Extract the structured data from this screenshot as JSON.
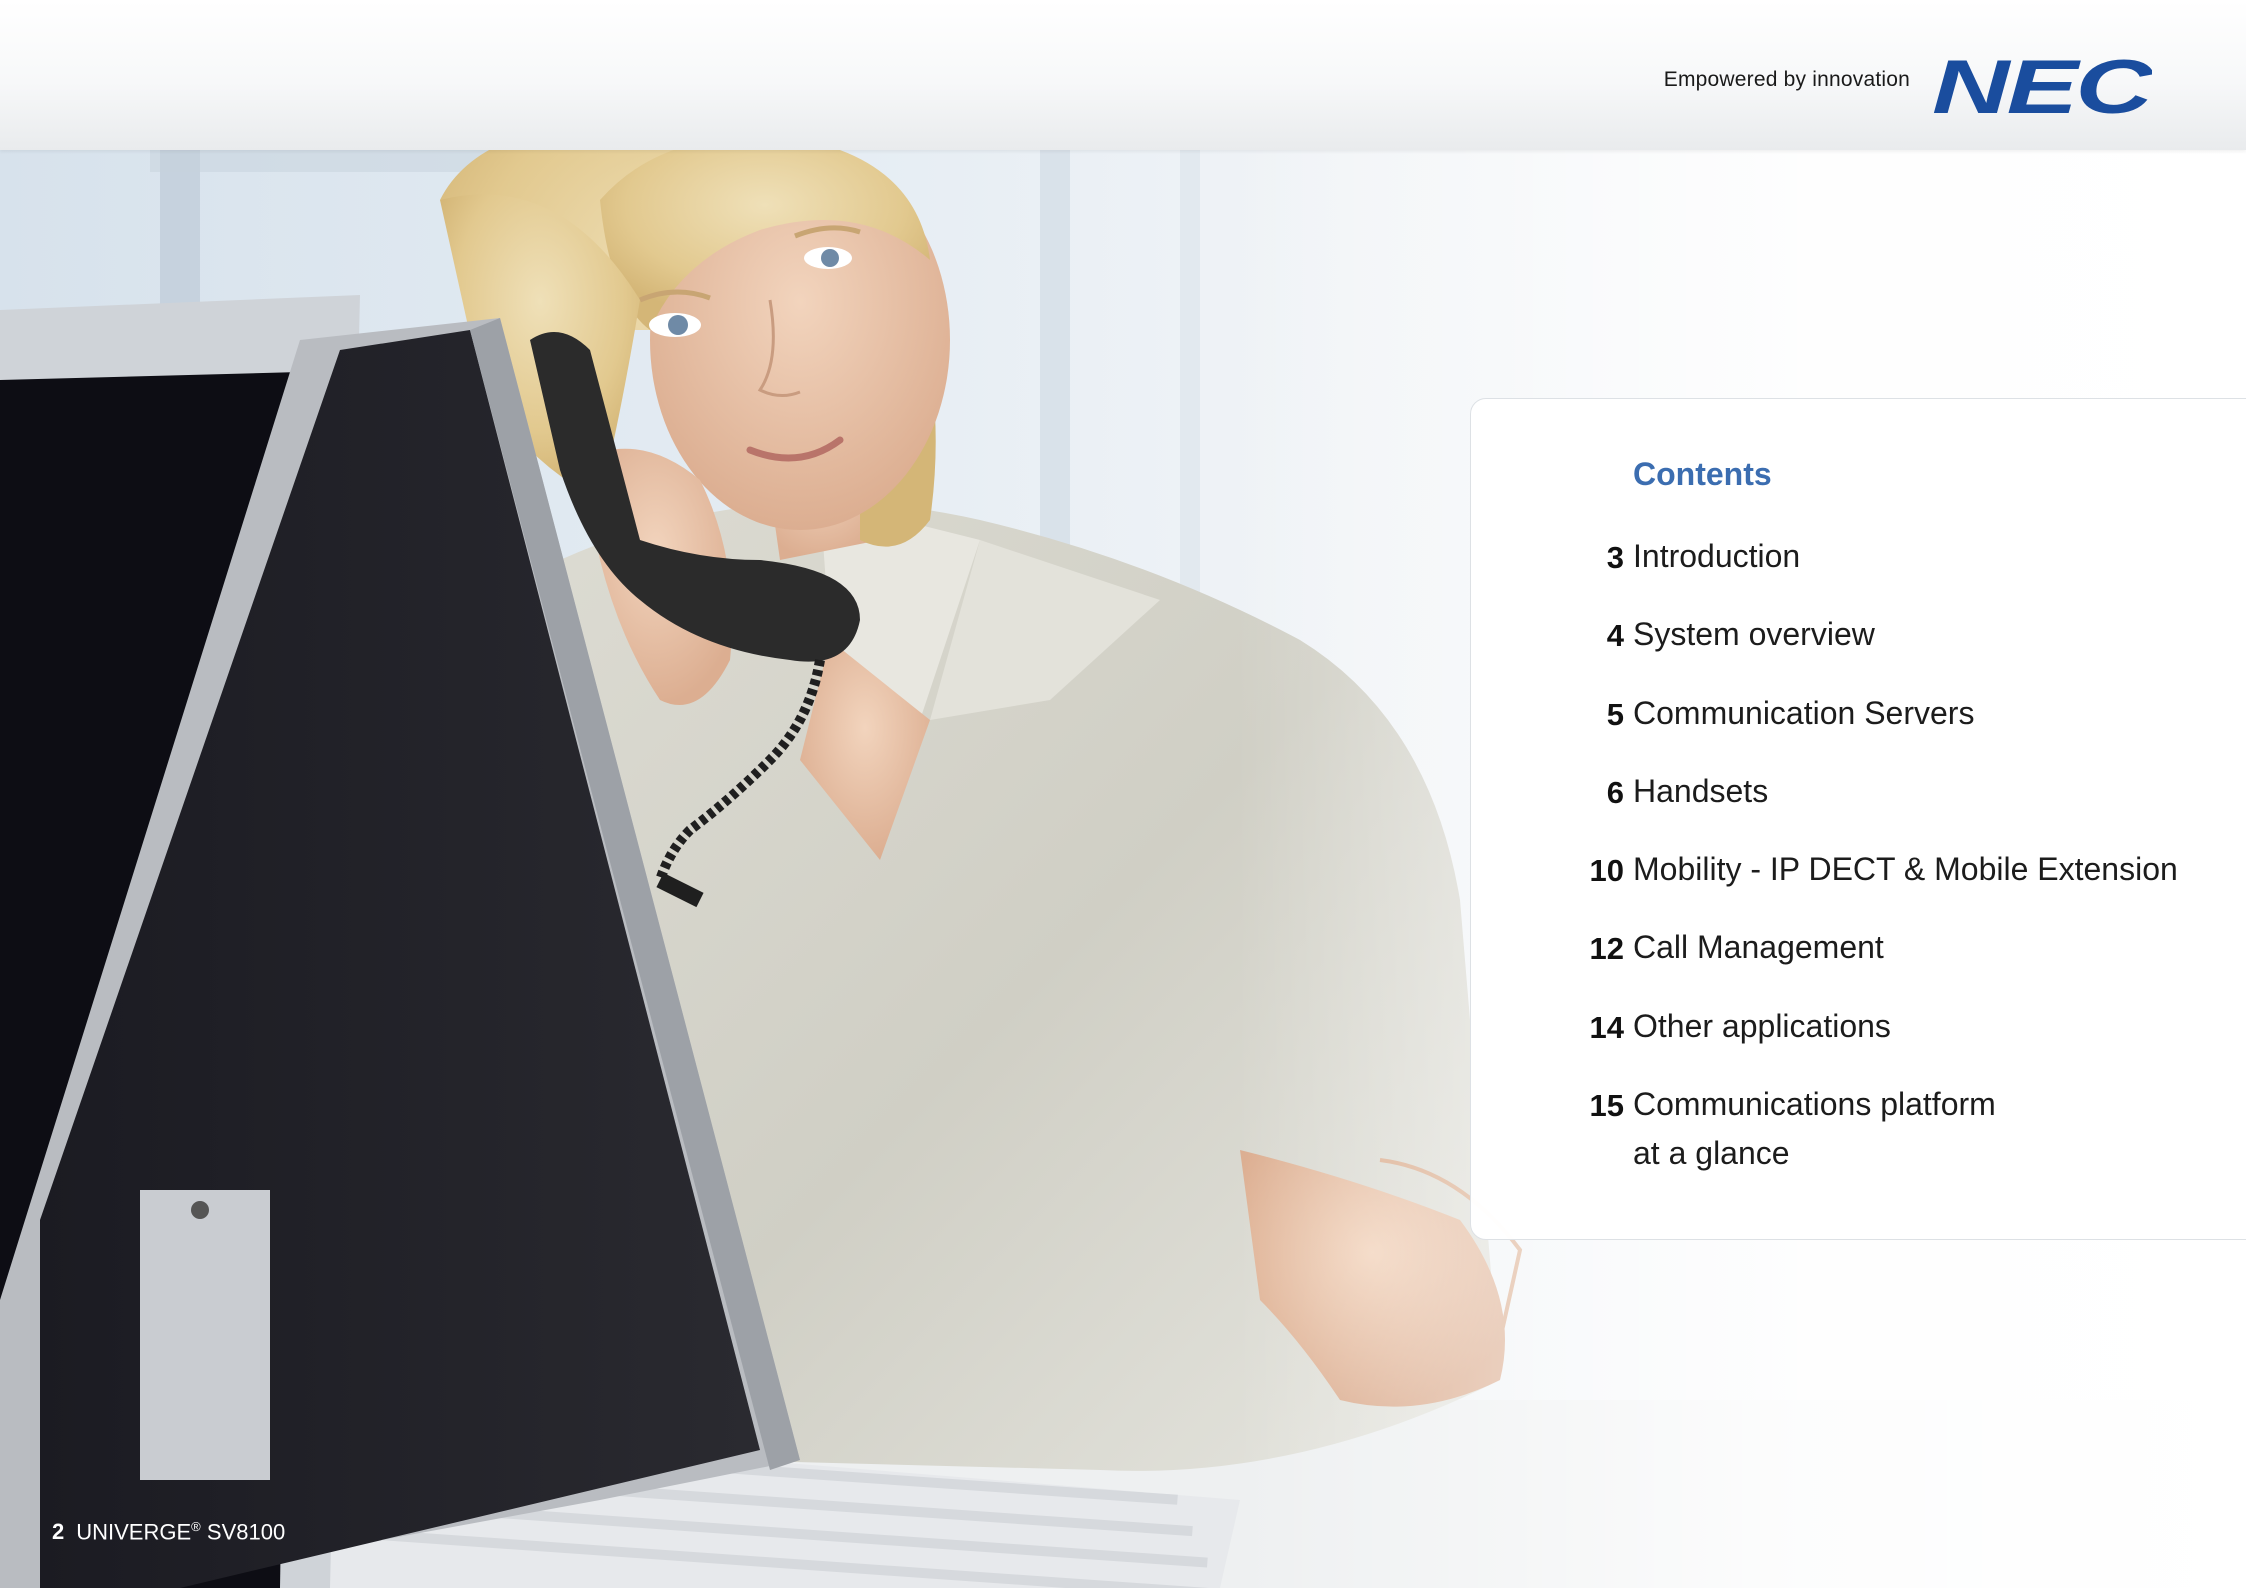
{
  "header": {
    "tagline": "Empowered by innovation",
    "logo_text": "NEC",
    "brand_color": "#1a4d9e"
  },
  "contents": {
    "title": "Contents",
    "title_color": "#3b6db0",
    "items": [
      {
        "page": "3",
        "label": "Introduction"
      },
      {
        "page": "4",
        "label": "System overview"
      },
      {
        "page": "5",
        "label": "Communication Servers"
      },
      {
        "page": "6",
        "label": "Handsets"
      },
      {
        "page": "10",
        "label": "Mobility - IP DECT & Mobile Extension"
      },
      {
        "page": "12",
        "label": "Call Management"
      },
      {
        "page": "14",
        "label": "Other applications"
      },
      {
        "page": "15",
        "label": "Communications platform at a glance"
      }
    ]
  },
  "footer": {
    "page_number": "2",
    "product": "UNIVERGE",
    "registered": "®",
    "model": "SV8100"
  }
}
